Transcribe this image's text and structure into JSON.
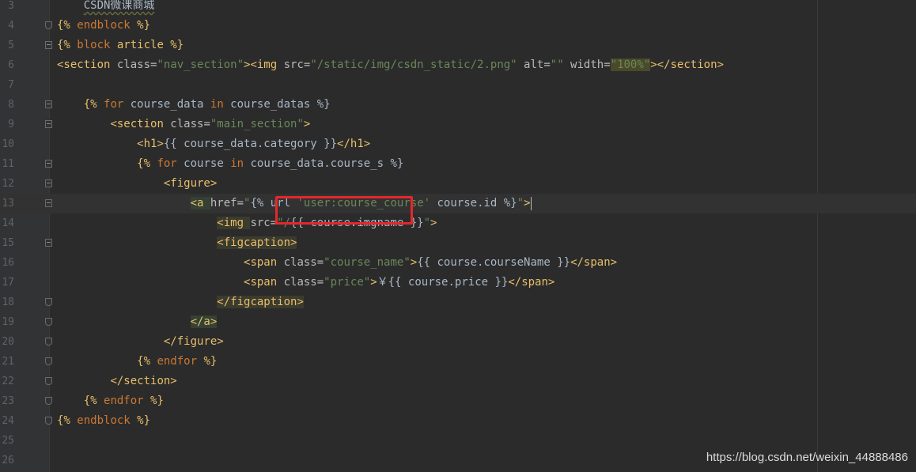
{
  "editor": {
    "lines": [
      {
        "num": "3",
        "segments": [
          {
            "t": "    ",
            "c": "plain"
          },
          {
            "t": "CSDN微课商城",
            "c": "plain"
          }
        ]
      },
      {
        "num": "4",
        "segments": [
          {
            "t": "{% ",
            "c": "tmpl"
          },
          {
            "t": "endblock",
            "c": "kw"
          },
          {
            "t": " %}",
            "c": "tmpl"
          }
        ]
      },
      {
        "num": "5",
        "segments": [
          {
            "t": "{% ",
            "c": "tmpl"
          },
          {
            "t": "block",
            "c": "kw"
          },
          {
            "t": " article %}",
            "c": "tmpl"
          }
        ]
      },
      {
        "num": "6",
        "segments": [
          {
            "t": "<section ",
            "c": "tag"
          },
          {
            "t": "class=",
            "c": "attr"
          },
          {
            "t": "\"nav_section\"",
            "c": "str"
          },
          {
            "t": "><img ",
            "c": "tag"
          },
          {
            "t": "src=",
            "c": "attr"
          },
          {
            "t": "\"/static/img/csdn_static/2.png\"",
            "c": "str"
          },
          {
            "t": " alt=",
            "c": "attr"
          },
          {
            "t": "\"\"",
            "c": "str"
          },
          {
            "t": " width=",
            "c": "attr"
          },
          {
            "t": "\"100%\"",
            "c": "str"
          },
          {
            "t": "></section>",
            "c": "tag"
          }
        ]
      },
      {
        "num": "7",
        "segments": []
      },
      {
        "num": "8",
        "segments": [
          {
            "t": "    ",
            "c": "plain"
          },
          {
            "t": "{% ",
            "c": "tmpl"
          },
          {
            "t": "for",
            "c": "kw"
          },
          {
            "t": " course_data ",
            "c": "plain"
          },
          {
            "t": "in",
            "c": "kw"
          },
          {
            "t": " course_datas %}",
            "c": "plain"
          }
        ]
      },
      {
        "num": "9",
        "segments": [
          {
            "t": "        ",
            "c": "plain"
          },
          {
            "t": "<section ",
            "c": "tag"
          },
          {
            "t": "class=",
            "c": "attr"
          },
          {
            "t": "\"main_section\"",
            "c": "str"
          },
          {
            "t": ">",
            "c": "tag"
          }
        ]
      },
      {
        "num": "10",
        "segments": [
          {
            "t": "            ",
            "c": "plain"
          },
          {
            "t": "<h1>",
            "c": "tag"
          },
          {
            "t": "{{ course_data.category }}",
            "c": "plain"
          },
          {
            "t": "</h1>",
            "c": "tag"
          }
        ]
      },
      {
        "num": "11",
        "segments": [
          {
            "t": "            ",
            "c": "plain"
          },
          {
            "t": "{% ",
            "c": "tmpl"
          },
          {
            "t": "for",
            "c": "kw"
          },
          {
            "t": " course ",
            "c": "plain"
          },
          {
            "t": "in",
            "c": "kw"
          },
          {
            "t": " course_data.course_s %}",
            "c": "plain"
          }
        ]
      },
      {
        "num": "12",
        "segments": [
          {
            "t": "                ",
            "c": "plain"
          },
          {
            "t": "<figure>",
            "c": "tag"
          }
        ]
      },
      {
        "num": "13",
        "current": true,
        "segments": [
          {
            "t": "                    ",
            "c": "plain"
          },
          {
            "t": "<a ",
            "c": "tag"
          },
          {
            "t": "href=",
            "c": "attr"
          },
          {
            "t": "\"",
            "c": "str"
          },
          {
            "t": "{% url ",
            "c": "plain"
          },
          {
            "t": "'user:course_course'",
            "c": "str"
          },
          {
            "t": " course.id %}",
            "c": "plain"
          },
          {
            "t": "\"",
            "c": "str"
          },
          {
            "t": ">",
            "c": "tag"
          }
        ]
      },
      {
        "num": "14",
        "segments": [
          {
            "t": "                        ",
            "c": "plain"
          },
          {
            "t": "<img ",
            "c": "tag"
          },
          {
            "t": "src=",
            "c": "attr"
          },
          {
            "t": "\"/",
            "c": "str"
          },
          {
            "t": "{{ course.imgname }}",
            "c": "plain"
          },
          {
            "t": "\"",
            "c": "str"
          },
          {
            "t": ">",
            "c": "tag"
          }
        ]
      },
      {
        "num": "15",
        "segments": [
          {
            "t": "                        ",
            "c": "plain"
          },
          {
            "t": "<figcaption>",
            "c": "tag"
          }
        ]
      },
      {
        "num": "16",
        "segments": [
          {
            "t": "                            ",
            "c": "plain"
          },
          {
            "t": "<span ",
            "c": "tag"
          },
          {
            "t": "class=",
            "c": "attr"
          },
          {
            "t": "\"course_name\"",
            "c": "str"
          },
          {
            "t": ">",
            "c": "tag"
          },
          {
            "t": "{{ course.courseName }}",
            "c": "plain"
          },
          {
            "t": "</span>",
            "c": "tag"
          }
        ]
      },
      {
        "num": "17",
        "segments": [
          {
            "t": "                            ",
            "c": "plain"
          },
          {
            "t": "<span ",
            "c": "tag"
          },
          {
            "t": "class=",
            "c": "attr"
          },
          {
            "t": "\"price\"",
            "c": "str"
          },
          {
            "t": ">",
            "c": "tag"
          },
          {
            "t": "￥{{ course.price }}",
            "c": "plain"
          },
          {
            "t": "</span>",
            "c": "tag"
          }
        ]
      },
      {
        "num": "18",
        "segments": [
          {
            "t": "                        ",
            "c": "plain"
          },
          {
            "t": "</figcaption>",
            "c": "tag"
          }
        ]
      },
      {
        "num": "19",
        "segments": [
          {
            "t": "                    ",
            "c": "plain"
          },
          {
            "t": "</a>",
            "c": "tag"
          }
        ]
      },
      {
        "num": "20",
        "segments": [
          {
            "t": "                ",
            "c": "plain"
          },
          {
            "t": "</figure>",
            "c": "tag"
          }
        ]
      },
      {
        "num": "21",
        "segments": [
          {
            "t": "            ",
            "c": "plain"
          },
          {
            "t": "{% ",
            "c": "tmpl"
          },
          {
            "t": "endfor",
            "c": "kw"
          },
          {
            "t": " %}",
            "c": "tmpl"
          }
        ]
      },
      {
        "num": "22",
        "segments": [
          {
            "t": "        ",
            "c": "plain"
          },
          {
            "t": "</section>",
            "c": "tag"
          }
        ]
      },
      {
        "num": "23",
        "segments": [
          {
            "t": "    ",
            "c": "plain"
          },
          {
            "t": "{% ",
            "c": "tmpl"
          },
          {
            "t": "endfor",
            "c": "kw"
          },
          {
            "t": " %}",
            "c": "tmpl"
          }
        ]
      },
      {
        "num": "24",
        "segments": [
          {
            "t": "{% ",
            "c": "tmpl"
          },
          {
            "t": "endblock",
            "c": "kw"
          },
          {
            "t": " %}",
            "c": "tmpl"
          }
        ]
      },
      {
        "num": "25",
        "segments": []
      },
      {
        "num": "26",
        "segments": []
      }
    ],
    "fold_markers": {
      "3": "none",
      "4": "end",
      "5": "open",
      "6": "none",
      "7": "none",
      "8": "open",
      "9": "open",
      "10": "none",
      "11": "open",
      "12": "open",
      "13": "open",
      "14": "none",
      "15": "open",
      "16": "none",
      "17": "none",
      "18": "end",
      "19": "end",
      "20": "end",
      "21": "end",
      "22": "end",
      "23": "end",
      "24": "end",
      "25": "none",
      "26": "none"
    }
  },
  "watermark": "https://blog.csdn.net/weixin_44888486",
  "colors": {
    "background": "#2b2b2b",
    "gutter": "#313335",
    "tag": "#e8bf6a",
    "string": "#6a8759",
    "keyword": "#cc7832",
    "text": "#a9b7c6",
    "highlight_box": "#e8262a"
  }
}
